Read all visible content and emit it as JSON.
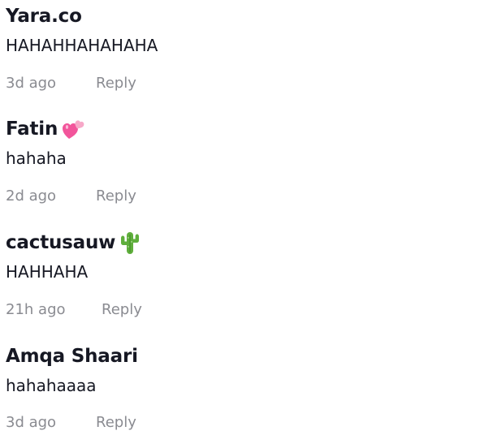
{
  "comments": [
    {
      "author": "Yara.co",
      "text": "HAHAHHAHAHAHA",
      "time": "3d ago",
      "reply_label": "Reply",
      "emoji": null
    },
    {
      "author": "Fatin",
      "text": "hahaha",
      "time": "2d ago",
      "reply_label": "Reply",
      "emoji": "two-hearts-icon"
    },
    {
      "author": "cactusauw",
      "text": "HAHHAHA",
      "time": "21h ago",
      "reply_label": "Reply",
      "emoji": "cactus-icon"
    },
    {
      "author": "Amqa Shaari",
      "text": "hahahaaaa",
      "time": "3d ago",
      "reply_label": "Reply",
      "emoji": null
    }
  ],
  "colors": {
    "author": "#161823",
    "text": "#161823",
    "meta": "#8a8b91",
    "background": "#ffffff",
    "heart": "#f2559b",
    "cactus": "#5fae3c"
  }
}
